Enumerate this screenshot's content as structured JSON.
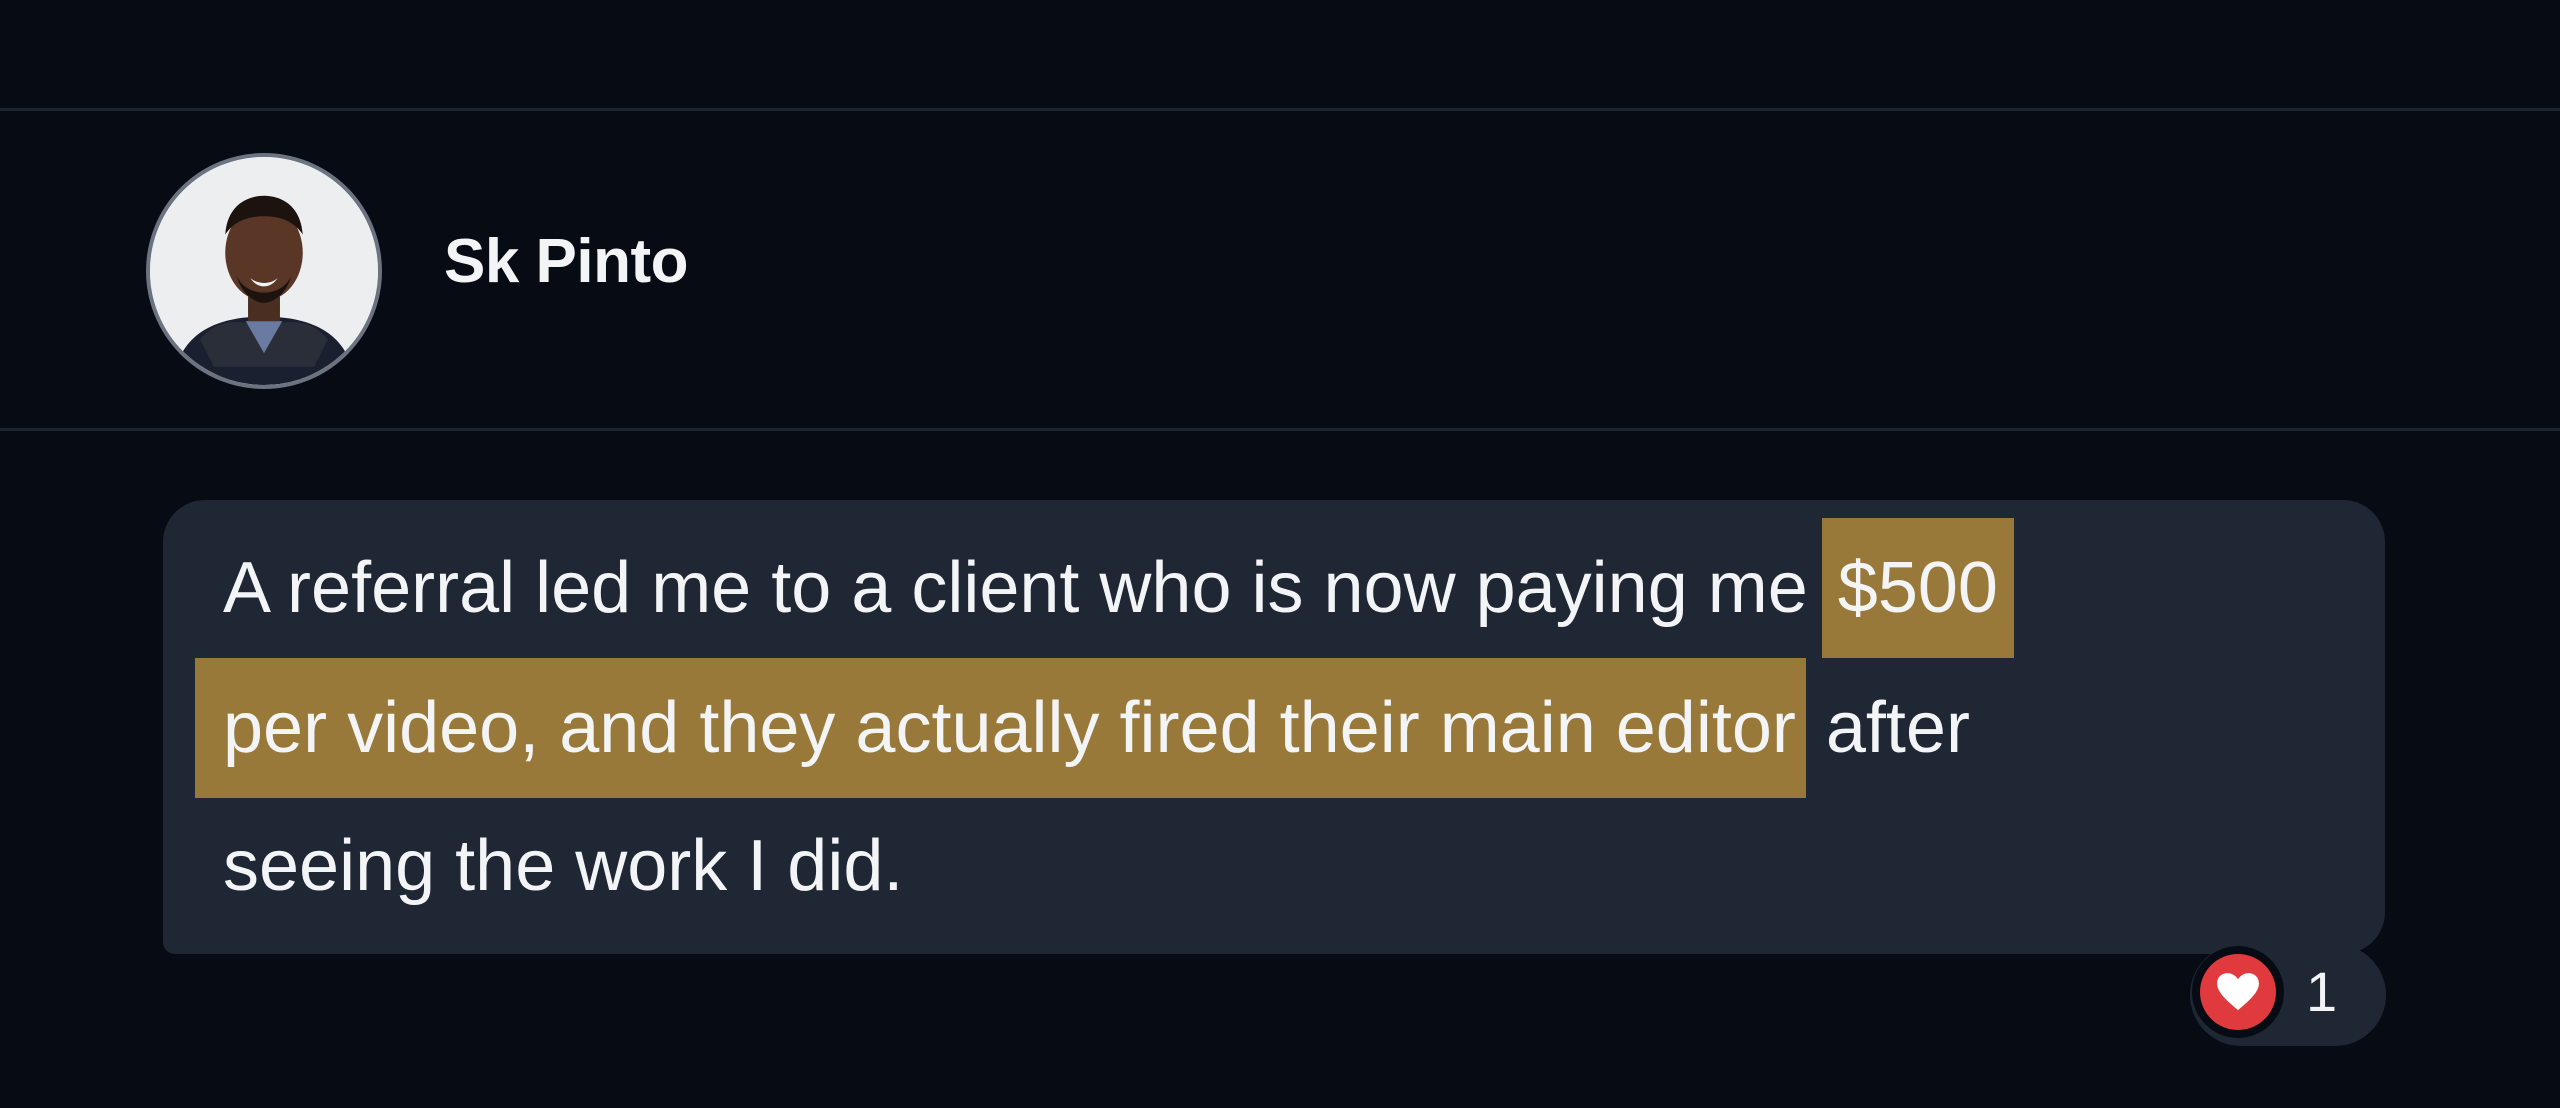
{
  "post": {
    "author": {
      "name": "Sk Pinto",
      "avatar_icon": "avatar-photo"
    },
    "message": {
      "line1_text": "A referral led me to a client who is now paying me ",
      "line1_highlight": "$500",
      "line2_highlight": "per video, and they actually fired their main editor",
      "line2_text": " after",
      "line3_text": "seeing the work I did."
    },
    "reaction": {
      "icon": "heart-icon",
      "count": "1"
    }
  },
  "colors": {
    "background": "#070b13",
    "bubble": "#1f2735",
    "highlight": "#98793a",
    "heart": "#e03a3e",
    "text": "#f3f4f6"
  }
}
